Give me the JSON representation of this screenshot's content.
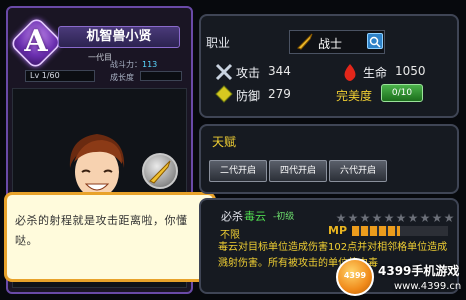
{
  "hero": {
    "rank_letter": "A",
    "name": "机智兽小贤",
    "generation": "一代目",
    "combat_label": "战斗力：",
    "combat_power": "113",
    "level": "Lv  1/60",
    "growth_label": "成长度",
    "growth_value": "0"
  },
  "dialog": {
    "text": "必杀的射程就是攻击距离啦，你懂哒。"
  },
  "info": {
    "job_label": "职业",
    "job_value": "战士",
    "attack_label": "攻击",
    "attack_value": "344",
    "hp_label": "生命",
    "hp_value": "1050",
    "defense_label": "防御",
    "defense_value": "279",
    "perfection_label": "完美度",
    "perfection_value": "0/10"
  },
  "talent": {
    "title": "天赋",
    "buttons": [
      "二代开启",
      "四代开启",
      "六代开启"
    ]
  },
  "skill": {
    "type": "必杀",
    "name": "毒云",
    "level": "-初级",
    "stars_total": 10,
    "stars_filled": 0,
    "cost": "不限",
    "mp_label": "MP",
    "mp_fraction": 0.5,
    "description": "毒云对目标单位造成伤害102点并对相邻格单位造成溅射伤害。所有被攻击的单位将中毒",
    "colors": {
      "mp_fill": "#ec9c1c",
      "accent": "#f0cf33"
    }
  },
  "watermark": {
    "logo": "4399",
    "title": "4399手机游戏",
    "url": "www.4399.cn"
  }
}
